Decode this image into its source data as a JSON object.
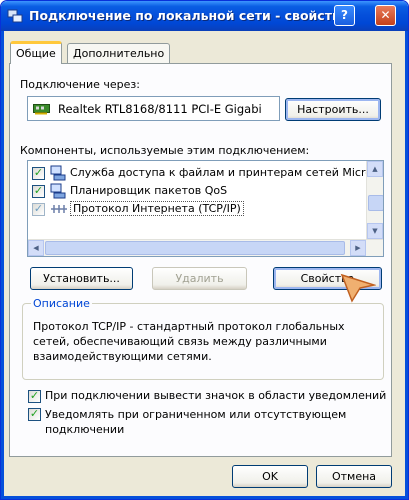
{
  "window": {
    "title": "Подключение по локальной сети - свойства",
    "help_glyph": "?",
    "close_glyph": "✕"
  },
  "tabs": [
    {
      "label": "Общие"
    },
    {
      "label": "Дополнительно"
    }
  ],
  "connect": {
    "label": "Подключение через:",
    "adapter": "Realtek RTL8168/8111 PCI-E Gigabi",
    "configure_label": "Настроить..."
  },
  "components": {
    "label": "Компоненты, используемые этим подключением:",
    "items": [
      {
        "label": "Служба доступа к файлам и принтерам сетей Micro",
        "checked": true
      },
      {
        "label": "Планировщик пакетов QoS",
        "checked": true
      },
      {
        "label": "Протокол Интернета (TCP/IP)",
        "checked": true,
        "selected": true
      }
    ]
  },
  "buttons": {
    "install": "Установить...",
    "remove": "Удалить",
    "properties": "Свойства",
    "ok": "OK",
    "cancel": "Отмена"
  },
  "description": {
    "title": "Описание",
    "text": "Протокол TCP/IP - стандартный протокол глобальных сетей, обеспечивающий связь между различными взаимодействующими сетями."
  },
  "options": [
    {
      "label": "При подключении вывести значок в области уведомлений",
      "checked": true
    },
    {
      "label": "Уведомлять при ограниченном или отсутствующем подключении",
      "checked": true
    }
  ],
  "colors": {
    "titlebar": "#0550db",
    "accent": "#0046d5",
    "face": "#ece9d8"
  }
}
